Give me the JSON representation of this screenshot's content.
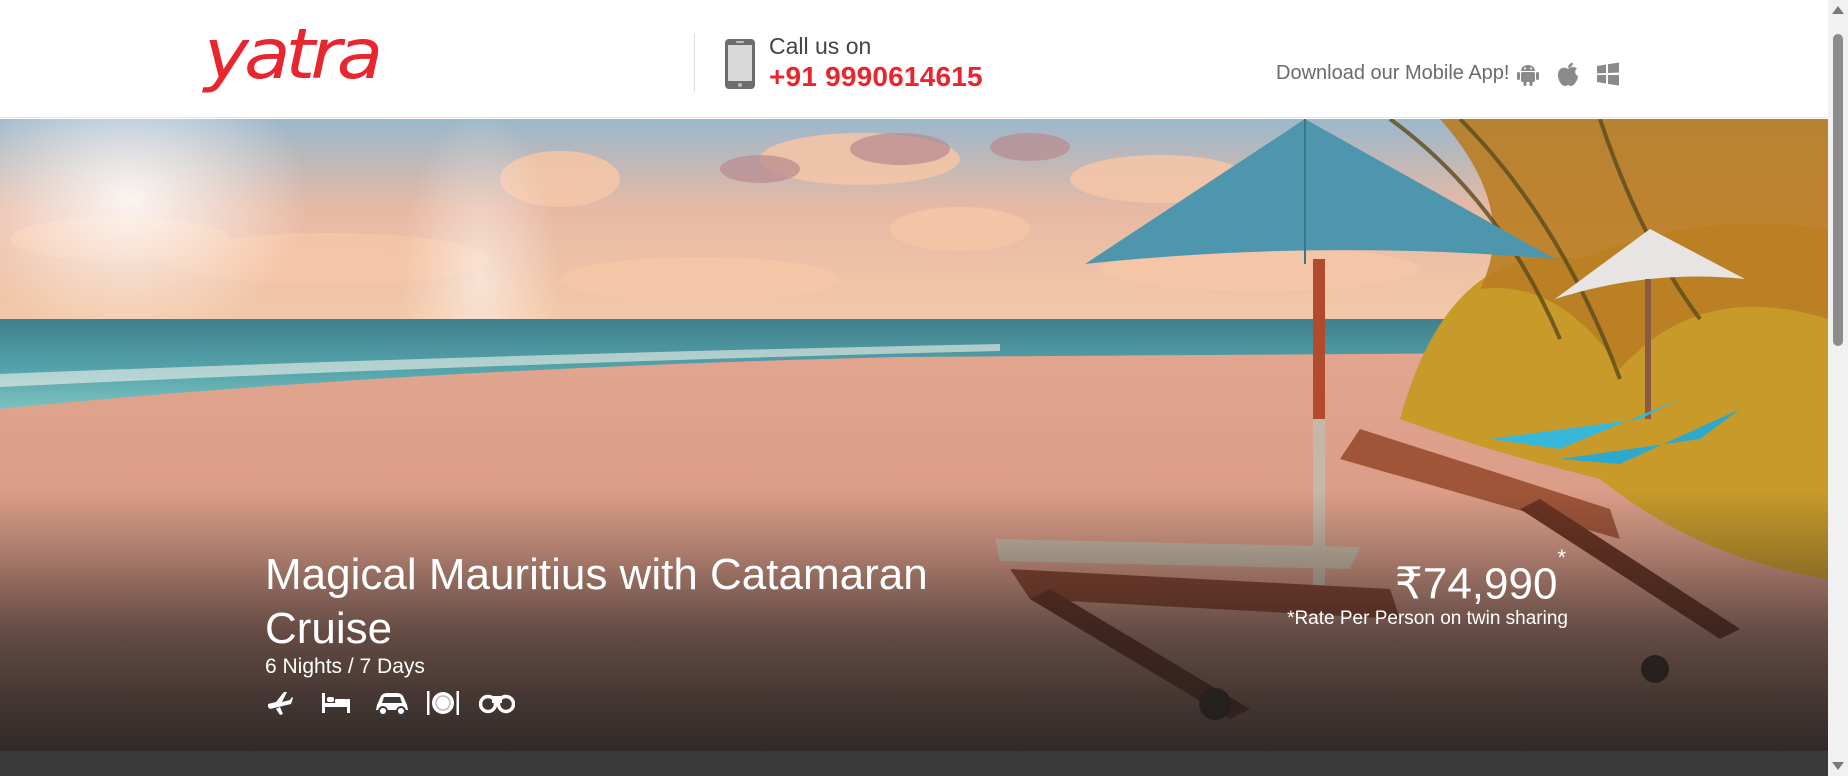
{
  "header": {
    "logo_text": "yatra",
    "call_label": "Call us on",
    "call_number": "+91 9990614615",
    "app_label": "Download our Mobile App!",
    "app_icons": [
      "android-icon",
      "apple-icon",
      "windows-icon"
    ]
  },
  "package": {
    "title": "Magical Mauritius with Catamaran Cruise",
    "duration": "6 Nights / 7 Days",
    "inclusions": [
      "flight-icon",
      "hotel-bed-icon",
      "car-transfer-icon",
      "meals-icon",
      "sightseeing-binoculars-icon"
    ],
    "price": "₹74,990",
    "price_marker": "*",
    "price_note": "*Rate Per Person on twin sharing"
  },
  "colors": {
    "brand_red": "#e8262f",
    "bottom_bar": "#3a3a3a"
  }
}
